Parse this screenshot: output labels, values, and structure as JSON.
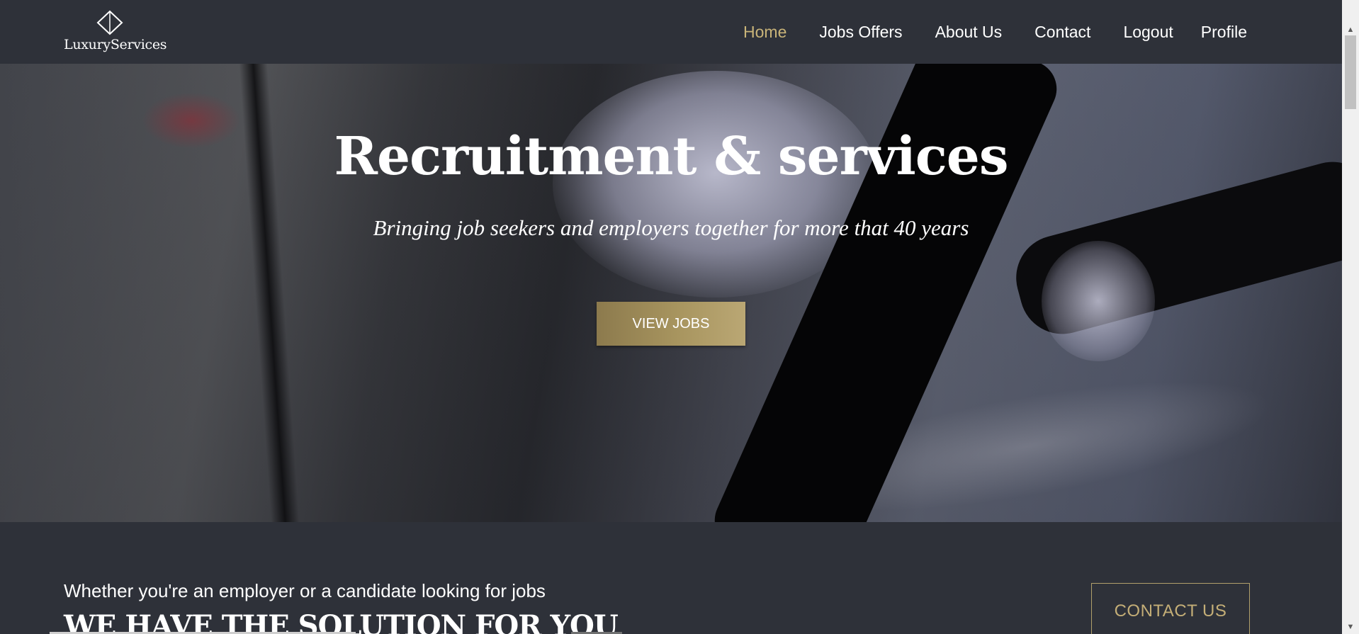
{
  "brand": {
    "name": "LuxuryServices",
    "logo_icon": "diamond-icon"
  },
  "nav": {
    "items": [
      {
        "label": "Home",
        "active": true
      },
      {
        "label": "Jobs Offers",
        "active": false
      },
      {
        "label": "About Us",
        "active": false
      },
      {
        "label": "Contact",
        "active": false
      },
      {
        "label": "Logout",
        "active": false
      },
      {
        "label": "Profile",
        "active": false
      }
    ]
  },
  "hero": {
    "title": "Recruitment & services",
    "subtitle": "Bringing job seekers and employers together for more that 40 years",
    "button_label": "VIEW JOBS"
  },
  "cta": {
    "lead": "Whether you're an employer or a candidate looking for jobs",
    "heading": "WE HAVE THE SOLUTION FOR YOU",
    "button_label": "CONTACT US"
  },
  "colors": {
    "background": "#2e3139",
    "accent": "#c9b479",
    "button_gold": "#a8955f",
    "text": "#ffffff"
  }
}
